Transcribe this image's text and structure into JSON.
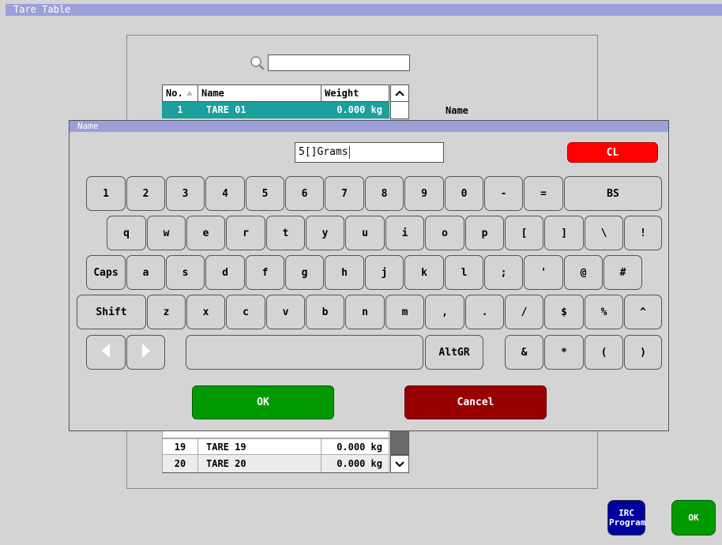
{
  "window": {
    "title": "Tare Table"
  },
  "search": {
    "value": "",
    "placeholder": ""
  },
  "table": {
    "headers": {
      "no": "No.",
      "name": "Name",
      "weight": "Weight"
    },
    "top_rows": [
      {
        "no": "1",
        "name": "TARE 01",
        "weight": "0.000 kg"
      }
    ],
    "bottom_rows": [
      {
        "no": "19",
        "name": "TARE 19",
        "weight": "0.000 kg"
      },
      {
        "no": "20",
        "name": "TARE 20",
        "weight": "0.000 kg"
      }
    ]
  },
  "side_label": "Name",
  "dialog": {
    "title": "Name",
    "input_value": "5[]Grams",
    "clear_label": "CL",
    "ok_label": "OK",
    "cancel_label": "Cancel"
  },
  "keyboard": {
    "row1": [
      "1",
      "2",
      "3",
      "4",
      "5",
      "6",
      "7",
      "8",
      "9",
      "0",
      "-",
      "=",
      "BS"
    ],
    "row2": [
      "q",
      "w",
      "e",
      "r",
      "t",
      "y",
      "u",
      "i",
      "o",
      "p",
      "[",
      "]",
      "\\",
      "!"
    ],
    "row3": [
      "Caps",
      "a",
      "s",
      "d",
      "f",
      "g",
      "h",
      "j",
      "k",
      "l",
      ";",
      "'",
      "@",
      "#"
    ],
    "row4": [
      "Shift",
      "z",
      "x",
      "c",
      "v",
      "b",
      "n",
      "m",
      ",",
      ".",
      "/",
      "$",
      "%",
      "^"
    ],
    "row5": {
      "altgr": "AltGR",
      "sym": [
        "&",
        "*",
        "(",
        ")"
      ],
      "space": ""
    }
  },
  "footer": {
    "irc_label": "IRC Program",
    "ok_label": "OK"
  },
  "colors": {
    "title_bar": "#9d9fd9",
    "selected_row": "#1b9f9f",
    "ok_green": "#009a00",
    "cancel_red": "#990000",
    "cl_red": "#ff0000",
    "irc_blue": "#0000a0"
  },
  "icons": [
    "search-icon",
    "sort-up-icon",
    "chevron-up-icon",
    "chevron-down-icon",
    "arrow-left-icon",
    "arrow-right-icon"
  ]
}
